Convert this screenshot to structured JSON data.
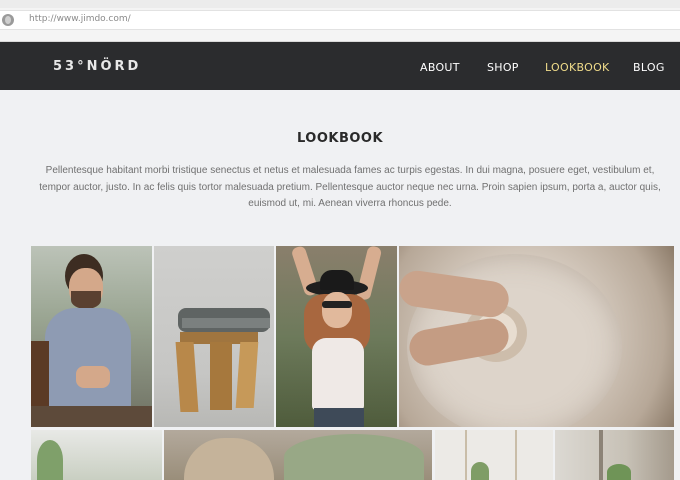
{
  "browser": {
    "url": "http://www.jimdo.com/"
  },
  "header": {
    "logo": "53°NÖRD",
    "nav": [
      {
        "label": "ABOUT",
        "active": false
      },
      {
        "label": "SHOP",
        "active": false
      },
      {
        "label": "LOOKBOOK",
        "active": true
      },
      {
        "label": "BLOG",
        "active": false
      }
    ]
  },
  "main": {
    "title": "LOOKBOOK",
    "description": "Pellentesque habitant morbi tristique senectus et netus et malesuada fames ac turpis egestas. In dui magna, posuere eget, vestibulum et, tempor auctor, justo. In ac felis quis tortor malesuada pretium. Pellentesque auctor neque nec urna. Proin sapien ipsum, porta a, auctor quis, euismod ut, mi. Aenean viverra rhoncus pede."
  },
  "colors": {
    "header_bg": "#2b2c2e",
    "nav_active": "#f0dc8a",
    "page_bg": "#f0f1f3"
  }
}
